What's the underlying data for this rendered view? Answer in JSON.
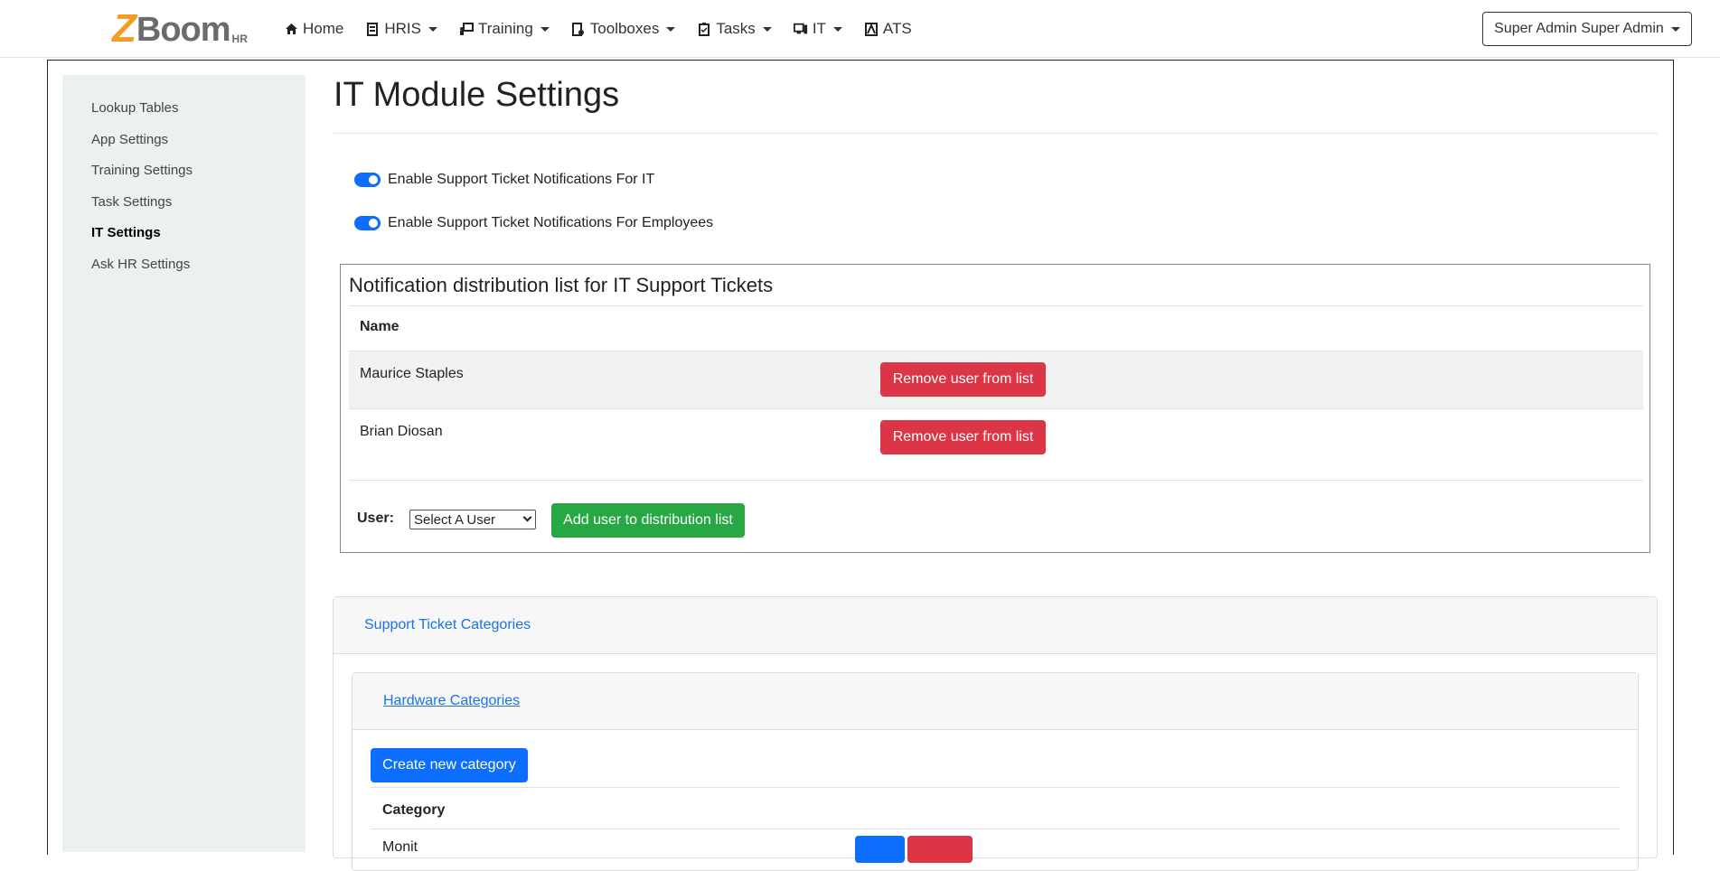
{
  "brand": {
    "z": "Z",
    "boom": "Boom",
    "hr": "HR"
  },
  "nav": {
    "home": "Home",
    "hris": "HRIS",
    "training": "Training",
    "toolboxes": "Toolboxes",
    "tasks": "Tasks",
    "it": "IT",
    "ats": "ATS"
  },
  "user_menu": "Super Admin Super Admin",
  "sidebar": {
    "items": [
      "Lookup Tables",
      "App Settings",
      "Training Settings",
      "Task Settings",
      "IT Settings",
      "Ask HR Settings"
    ],
    "active": "IT Settings"
  },
  "page": {
    "title": "IT Module Settings",
    "toggle_it": "Enable Support Ticket Notifications For IT",
    "toggle_employees": "Enable Support Ticket Notifications For Employees"
  },
  "distribution": {
    "title": "Notification distribution list for IT Support Tickets",
    "col_name": "Name",
    "rows": [
      {
        "name": "Maurice Staples",
        "action": "Remove user from list"
      },
      {
        "name": "Brian Diosan",
        "action": "Remove user from list"
      }
    ],
    "user_label": "User:",
    "select_value": "Select A User",
    "add_button": "Add user to distribution list"
  },
  "categories": {
    "header": "Support Ticket Categories",
    "hardware_header": "Hardware Categories",
    "create_button": "Create new category",
    "col_category": "Category",
    "first_row_partial": "Monit"
  }
}
